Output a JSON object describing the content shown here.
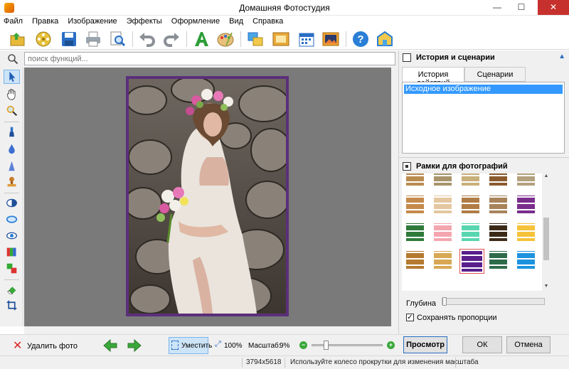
{
  "window": {
    "title": "Домашняя Фотостудия",
    "min": "—",
    "max": "☐",
    "close": "✕"
  },
  "menu": [
    "Файл",
    "Правка",
    "Изображение",
    "Эффекты",
    "Оформление",
    "Вид",
    "Справка"
  ],
  "search": {
    "placeholder": "поиск функций..."
  },
  "history_panel": {
    "header": "История и сценарии",
    "tabs": [
      "История действий",
      "Сценарии"
    ],
    "items": [
      "Исходное изображение"
    ]
  },
  "frames_panel": {
    "header": "Рамки для фотографий",
    "depth_label": "Глубина",
    "keep_proportions_label": "Сохранять пропорции",
    "keep_proportions_checked": true,
    "thumbnails": [
      [
        "#b98c4e",
        "#a7946a",
        "#c9b07a",
        "#8a5a2e",
        "#b3a07e"
      ],
      [
        "#c58a4c",
        "#e4c7a0",
        "#b07c45",
        "#a8835a",
        "#7a2e8c"
      ],
      [
        "#2f7a3a",
        "#f4a6b0",
        "#59d6b0",
        "#3c2a18",
        "#f5c23a"
      ],
      [
        "#b57a30",
        "#d8a854",
        "#5a1f8c",
        "#2f6b4a",
        "#1d93e0"
      ]
    ]
  },
  "bottom": {
    "delete_label": "Удалить фото",
    "fit_label": "Уместить",
    "zoom100_label": "100%",
    "scale_label": "Масштаб:",
    "scale_value": "9%",
    "preview_label": "Просмотр",
    "ok_label": "ОК",
    "cancel_label": "Отмена"
  },
  "status": {
    "dimensions": "3794x5618",
    "hint": "Используйте колесо прокрутки для изменения масштаба"
  },
  "colors": {
    "accent": "#3399ff",
    "close": "#c7312d",
    "frame": "#5b2f7a"
  }
}
